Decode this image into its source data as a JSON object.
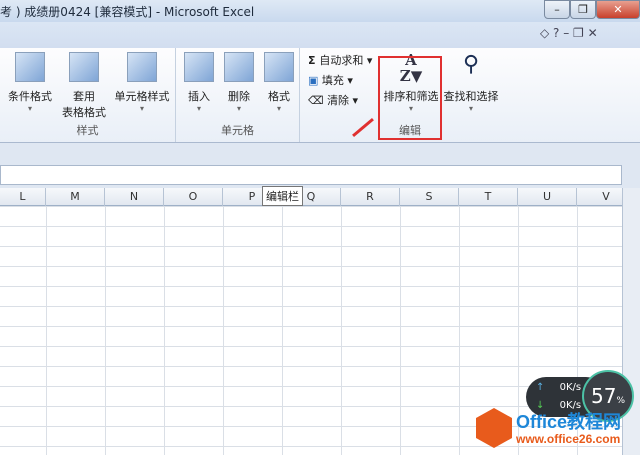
{
  "window": {
    "title": "考 ) 成绩册0424  [兼容模式]  -  Microsoft Excel",
    "min": "–",
    "restore": "❐",
    "close": "✕",
    "ribbon_ctrl": "◇ ? – ❐ ✕"
  },
  "ribbon": {
    "styles": {
      "label": "样式",
      "buttons": [
        "条件格式",
        "套用\n表格格式",
        "单元格样式"
      ]
    },
    "cells": {
      "label": "单元格",
      "buttons": [
        "插入",
        "删除",
        "格式"
      ]
    },
    "editing": {
      "label": "编辑",
      "autosum": "自动求和",
      "fill": "填充",
      "clear": "清除",
      "sort_filter": "排序和筛选",
      "find_select": "查找和选择"
    }
  },
  "columns": [
    "L",
    "M",
    "N",
    "O",
    "P",
    "Q",
    "R",
    "S",
    "T",
    "U",
    "V"
  ],
  "tooltip": "编辑栏",
  "net_widget": {
    "up": "0K/s",
    "down": "0K/s",
    "percent": "57",
    "unit": "%"
  },
  "watermark": {
    "brand": "Office教程网",
    "url": "www.office26.com"
  },
  "colors": {
    "highlight": "#e03030",
    "accent": "#1e87d8"
  }
}
